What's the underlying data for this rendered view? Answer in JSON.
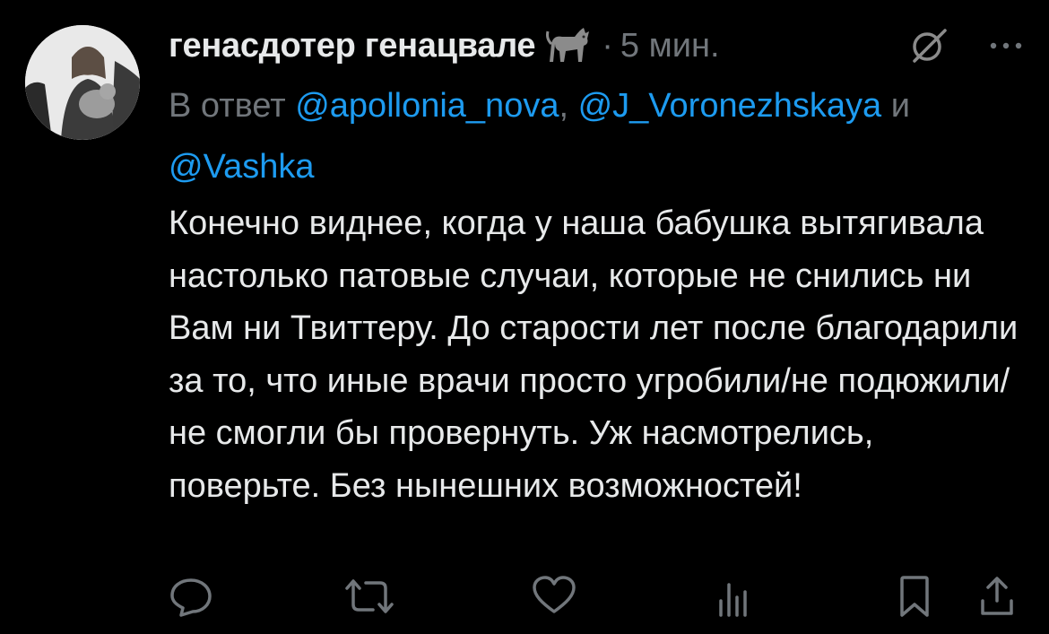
{
  "tweet": {
    "author_name": "генасдотер генацвале",
    "author_emoji": "black-cat-emoji",
    "separator": "·",
    "timestamp": "5 мин.",
    "reply_prefix": "В ответ",
    "mentions": [
      {
        "handle": "@apollonia_nova",
        "after": ", "
      },
      {
        "handle": "@J_Voronezhskaya",
        "after": " и "
      },
      {
        "handle": "@Vashka",
        "after": ""
      }
    ],
    "body": "Конечно виднее, когда у наша бабушка вытягивала настолько патовые случаи, которые не снились ни Вам ни Твиттеру. До старости лет после благодарили за то, что иные врачи просто угробили/не подюжили/не смогли бы провернуть. Уж насмотрелись, поверьте. Без нынешних возможностей!"
  },
  "icons": {
    "header": [
      "grok-icon",
      "more-icon"
    ],
    "actions": [
      "reply-icon",
      "retweet-icon",
      "like-icon",
      "views-icon",
      "bookmark-icon",
      "share-icon"
    ]
  },
  "colors": {
    "background": "#000000",
    "text": "#e7e9ea",
    "secondary": "#71767b",
    "link": "#1d9bf0"
  }
}
